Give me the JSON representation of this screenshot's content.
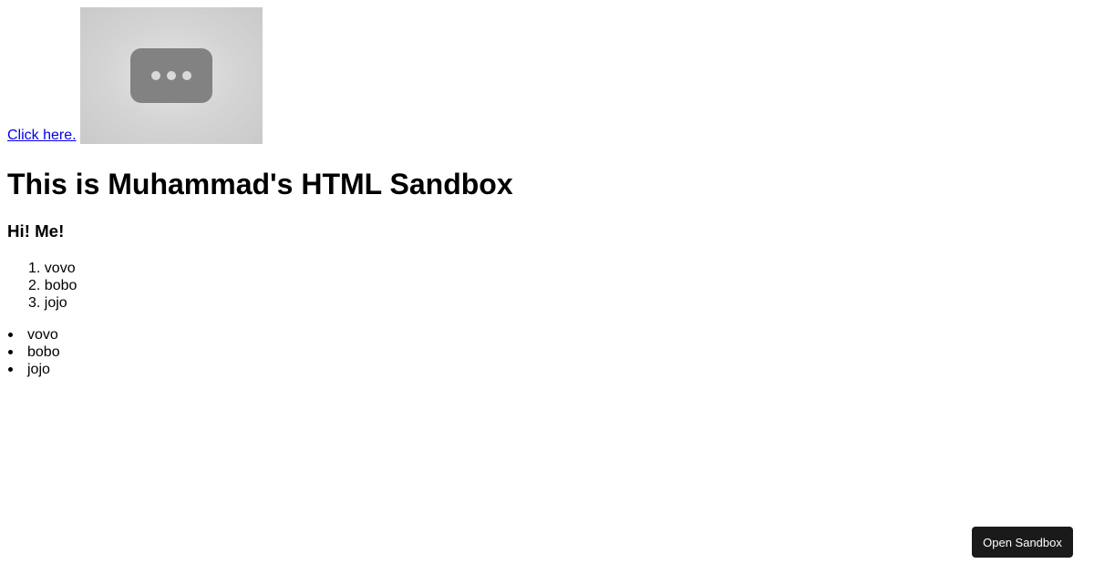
{
  "link": {
    "label": "Click here."
  },
  "thumbnail": {
    "icon": "more-dots-icon"
  },
  "heading1": "This is Muhammad's HTML Sandbox",
  "heading3": "Hi! Me!",
  "ordered_list": [
    {
      "marker": "1.",
      "text": "vovo"
    },
    {
      "marker": "2.",
      "text": "bobo"
    },
    {
      "marker": "3.",
      "text": "jojo"
    }
  ],
  "unordered_list": [
    "vovo",
    "bobo",
    "jojo"
  ],
  "open_sandbox_button": {
    "label": "Open Sandbox"
  },
  "colors": {
    "link": "#0000ee",
    "button_bg": "#1a1a1a",
    "button_text": "#ffffff"
  }
}
